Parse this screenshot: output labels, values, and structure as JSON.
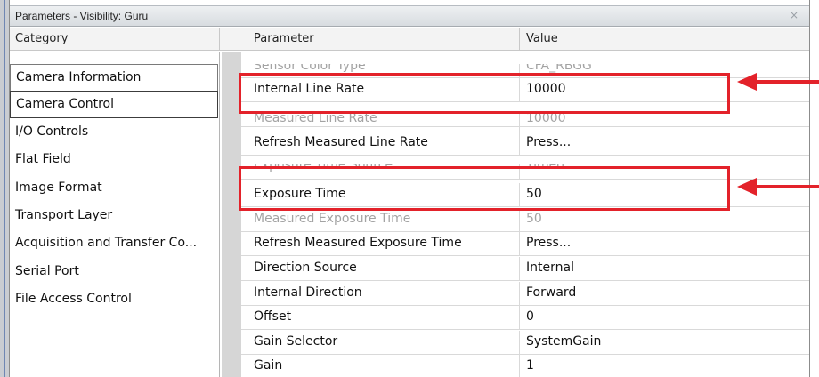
{
  "window": {
    "title": "Parameters - Visibility: Guru",
    "close_glyph": "×"
  },
  "columns": {
    "category": "Category",
    "parameter": "Parameter",
    "value": "Value"
  },
  "categories": [
    {
      "label": "Camera Information"
    },
    {
      "label": "Camera Control"
    },
    {
      "label": "I/O Controls"
    },
    {
      "label": "Flat Field"
    },
    {
      "label": "Image Format"
    },
    {
      "label": "Transport Layer"
    },
    {
      "label": "Acquisition and Transfer Co..."
    },
    {
      "label": "Serial Port"
    },
    {
      "label": "File Access Control"
    }
  ],
  "parameters": [
    {
      "name": "Sensor Color Type",
      "value": "CFA_RBGG",
      "disabled": true
    },
    {
      "name": "Internal Line Rate",
      "value": "10000",
      "disabled": false
    },
    {
      "name": "Measured Line Rate",
      "value": "10000",
      "disabled": true
    },
    {
      "name": "Refresh Measured Line Rate",
      "value": "Press...",
      "disabled": false
    },
    {
      "name": "Exposure Time Source",
      "value": "Timed",
      "disabled": true
    },
    {
      "name": "Exposure Time",
      "value": "50",
      "disabled": false
    },
    {
      "name": "Measured Exposure Time",
      "value": "50",
      "disabled": true
    },
    {
      "name": "Refresh Measured Exposure Time",
      "value": "Press...",
      "disabled": false
    },
    {
      "name": "Direction Source",
      "value": "Internal",
      "disabled": false
    },
    {
      "name": "Internal Direction",
      "value": "Forward",
      "disabled": false
    },
    {
      "name": "Offset",
      "value": "0",
      "disabled": false
    },
    {
      "name": "Gain Selector",
      "value": "SystemGain",
      "disabled": false
    },
    {
      "name": "Gain",
      "value": "1",
      "disabled": false
    }
  ],
  "annotation_color": "#e3222a",
  "selected_category": "Camera Control"
}
